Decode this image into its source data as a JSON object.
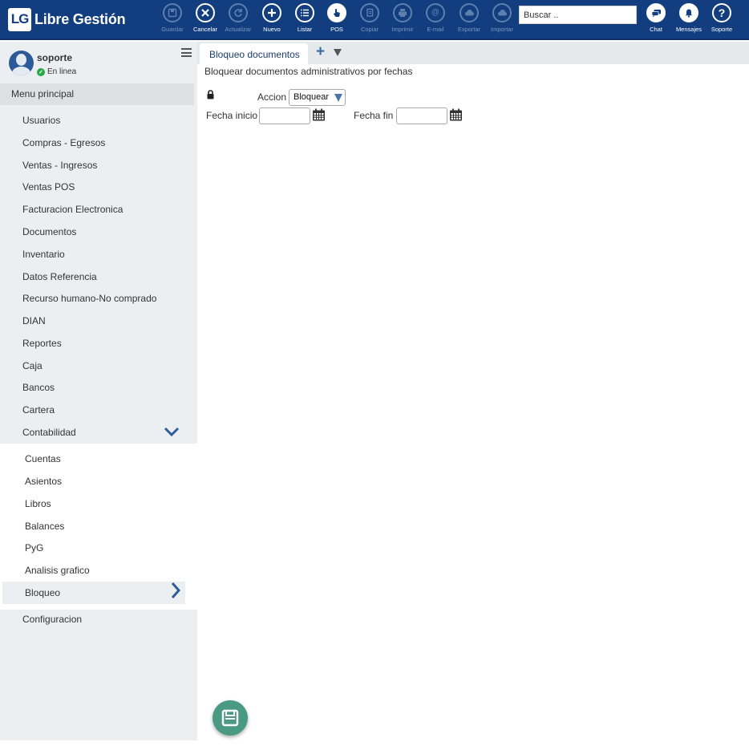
{
  "brand": {
    "logo_mark": "LG",
    "name": "Libre Gestión"
  },
  "toolbar": [
    {
      "label": "Guardar",
      "icon": "save-icon",
      "enabled": false
    },
    {
      "label": "Cancelar",
      "icon": "close-icon",
      "enabled": true
    },
    {
      "label": "Actualizar",
      "icon": "refresh-icon",
      "enabled": false
    },
    {
      "label": "Nuevo",
      "icon": "plus-icon",
      "enabled": true
    },
    {
      "label": "Listar",
      "icon": "list-icon",
      "enabled": true
    },
    {
      "label": "POS",
      "icon": "hand-pointer-icon",
      "enabled": true
    },
    {
      "label": "Copiar",
      "icon": "copy-icon",
      "enabled": false
    },
    {
      "label": "Imprimir",
      "icon": "print-icon",
      "enabled": false
    },
    {
      "label": "E-mail",
      "icon": "email-icon",
      "enabled": false
    },
    {
      "label": "Exportar",
      "icon": "cloud-upload-icon",
      "enabled": false
    },
    {
      "label": "Importar",
      "icon": "cloud-download-icon",
      "enabled": false
    }
  ],
  "search": {
    "placeholder": "Buscar ..",
    "value": ""
  },
  "top_right": [
    {
      "label": "Chat",
      "icon": "chat-icon"
    },
    {
      "label": "Mensajes",
      "icon": "bell-icon"
    },
    {
      "label": "Soporte",
      "icon": "help-icon"
    }
  ],
  "user": {
    "name": "soporte",
    "status": "En linea"
  },
  "sidebar": {
    "header": "Menu principal",
    "items": [
      "Usuarios",
      "Compras - Egresos",
      "Ventas - Ingresos",
      "Ventas POS",
      "Facturacion Electronica",
      "Documentos",
      "Inventario",
      "Datos Referencia",
      "Recurso humano-No comprado",
      "DIAN",
      "Reportes",
      "Caja",
      "Bancos",
      "Cartera",
      "Contabilidad"
    ],
    "subitems": [
      "Cuentas",
      "Asientos",
      "Libros",
      "Balances",
      "PyG",
      "Analisis grafico",
      "Bloqueo"
    ],
    "after": "Configuracion"
  },
  "tabs": {
    "active": "Bloqueo documentos"
  },
  "form": {
    "title": "Bloquear documentos administrativos por fechas",
    "accion_label": "Accion",
    "accion_value": "Bloquear",
    "fecha_inicio_label": "Fecha inicio",
    "fecha_inicio_value": "",
    "fecha_fin_label": "Fecha fin",
    "fecha_fin_value": ""
  },
  "colors": {
    "topbar": "#123e7f",
    "fab": "#4a9a83",
    "sidebar": "#eceff1"
  }
}
